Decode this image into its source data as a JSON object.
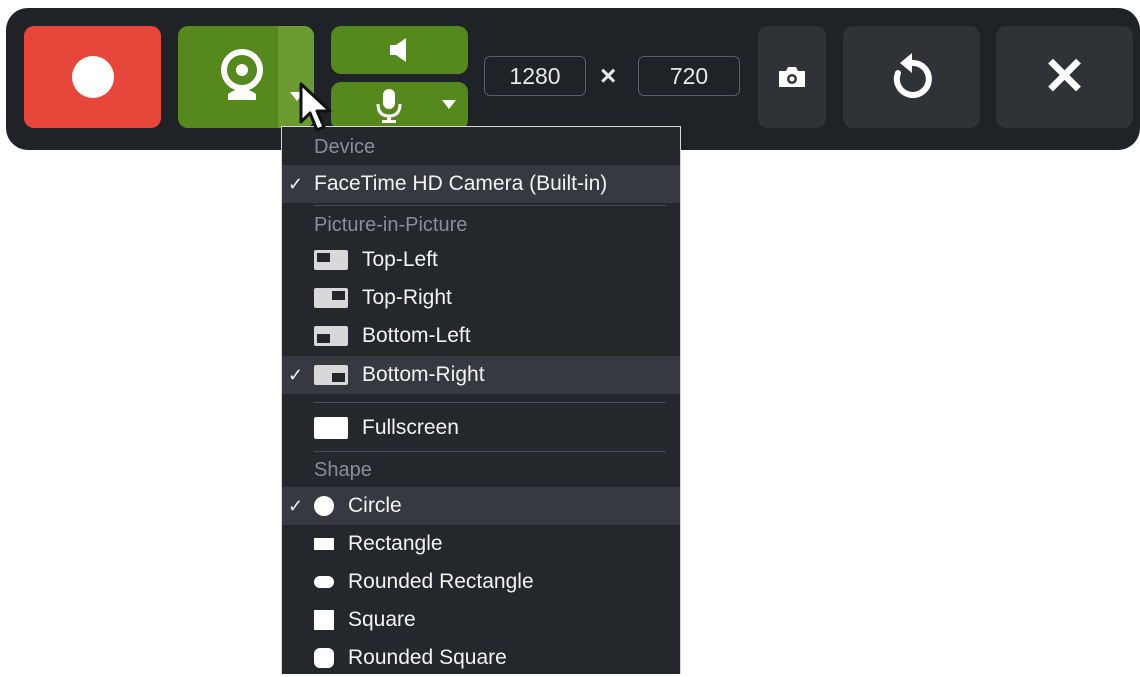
{
  "toolbar": {
    "width_value": "1280",
    "height_value": "720",
    "times_symbol": "×",
    "close_symbol": "✕",
    "colors": {
      "record": "#e7473b",
      "camera": "#56891d",
      "panel": "#1f2226",
      "button": "#2f3338"
    }
  },
  "menu": {
    "device_header": "Device",
    "device_item": "FaceTime HD Camera (Built-in)",
    "pip_header": "Picture-in-Picture",
    "pip_items": [
      "Top-Left",
      "Top-Right",
      "Bottom-Left",
      "Bottom-Right"
    ],
    "fullscreen": "Fullscreen",
    "shape_header": "Shape",
    "shape_items": [
      "Circle",
      "Rectangle",
      "Rounded Rectangle",
      "Square",
      "Rounded Square"
    ],
    "check": "✓",
    "selected": {
      "device": "FaceTime HD Camera (Built-in)",
      "pip": "Bottom-Right",
      "shape": "Circle"
    }
  }
}
